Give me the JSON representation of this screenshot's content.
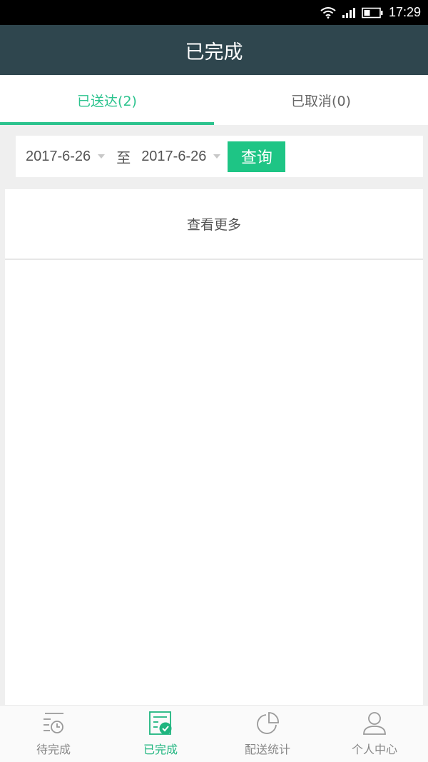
{
  "status_bar": {
    "time": "17:29",
    "icons": [
      "wifi-icon",
      "signal-icon",
      "battery-icon"
    ]
  },
  "header": {
    "title": "已完成"
  },
  "tabs": [
    {
      "label": "已送达(2)",
      "active": true
    },
    {
      "label": "已取消(0)",
      "active": false
    }
  ],
  "filter": {
    "start_date": "2017-6-26",
    "separator": "至",
    "end_date": "2017-6-26",
    "query_label": "查询"
  },
  "list": {
    "load_more_label": "查看更多"
  },
  "bottom_nav": [
    {
      "label": "待完成",
      "icon": "pending-list-icon",
      "active": false
    },
    {
      "label": "已完成",
      "icon": "completed-list-icon",
      "active": true
    },
    {
      "label": "配送统计",
      "icon": "pie-chart-icon",
      "active": false
    },
    {
      "label": "个人中心",
      "icon": "user-icon",
      "active": false
    }
  ],
  "colors": {
    "accent": "#2cc38e",
    "button": "#1ec585",
    "header_bg": "#2f464e"
  }
}
